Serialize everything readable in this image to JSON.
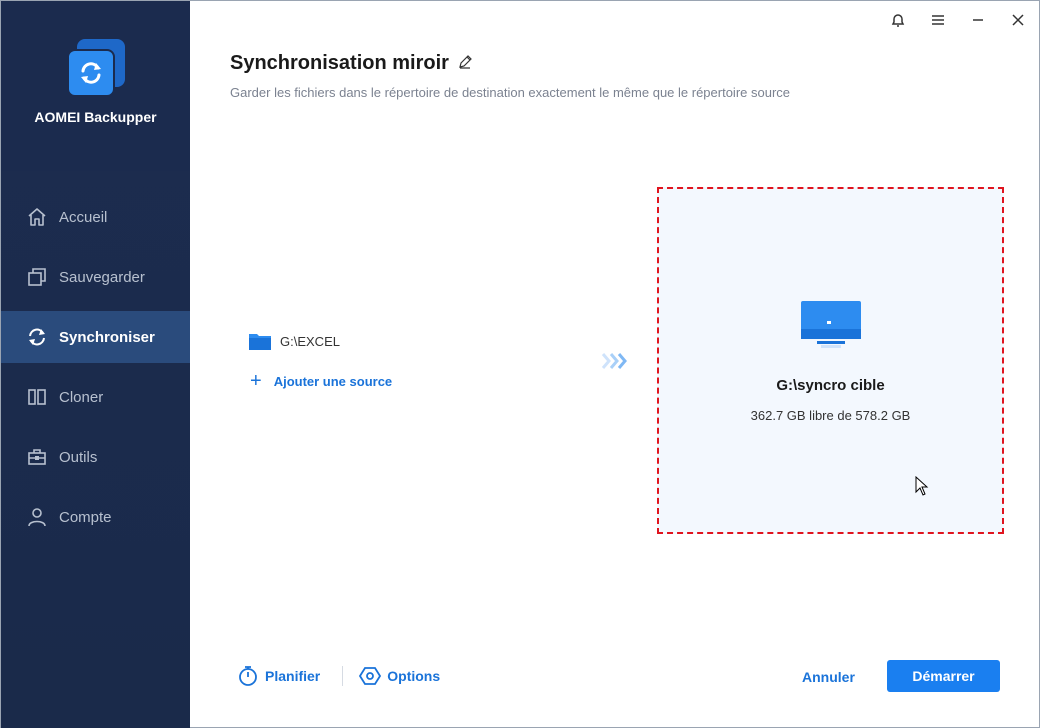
{
  "app": {
    "name": "AOMEI Backupper"
  },
  "sidebar": {
    "items": [
      {
        "label": "Accueil",
        "icon": "home-icon",
        "active": false
      },
      {
        "label": "Sauvegarder",
        "icon": "backup-icon",
        "active": false
      },
      {
        "label": "Synchroniser",
        "icon": "sync-icon",
        "active": true
      },
      {
        "label": "Cloner",
        "icon": "clone-icon",
        "active": false
      },
      {
        "label": "Outils",
        "icon": "toolbox-icon",
        "active": false
      },
      {
        "label": "Compte",
        "icon": "user-icon",
        "active": false
      }
    ]
  },
  "titlebar": {
    "icons": [
      "bell-icon",
      "menu-icon",
      "minimize-icon",
      "close-icon"
    ]
  },
  "main": {
    "title": "Synchronisation miroir",
    "subtitle": "Garder les fichiers dans le répertoire de destination exactement le même que le répertoire source",
    "source": {
      "path": "G:\\EXCEL"
    },
    "add_source_label": "Ajouter une source",
    "destination": {
      "name": "G:\\syncro cible",
      "space": "362.7 GB libre de 578.2 GB"
    }
  },
  "footer": {
    "schedule_label": "Planifier",
    "options_label": "Options",
    "cancel_label": "Annuler",
    "start_label": "Démarrer"
  },
  "colors": {
    "accent": "#1a7ff0",
    "sidebar_bg": "#1c2c4f",
    "sidebar_active": "#2a4b7c",
    "dest_border": "#e0141e"
  }
}
